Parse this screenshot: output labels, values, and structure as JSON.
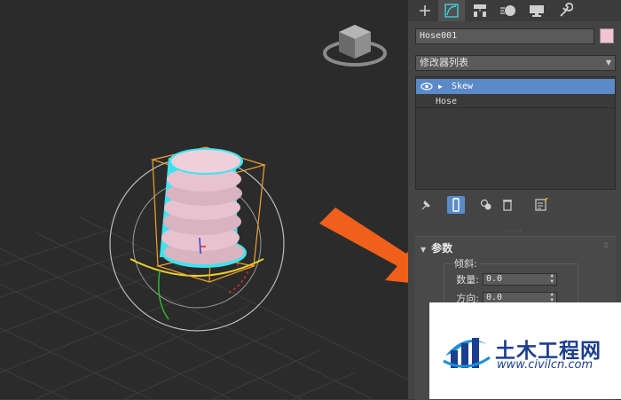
{
  "panel": {
    "tabs": [
      {
        "name": "create-tab",
        "icon": "plus-icon"
      },
      {
        "name": "modify-tab",
        "icon": "modify-curve-icon",
        "active": true
      },
      {
        "name": "hierarchy-tab",
        "icon": "hierarchy-icon"
      },
      {
        "name": "motion-tab",
        "icon": "motion-icon"
      },
      {
        "name": "display-tab",
        "icon": "display-monitor-icon"
      },
      {
        "name": "utilities-tab",
        "icon": "wrench-icon"
      }
    ],
    "object_name": "Hose001",
    "object_color": "#f2c4d3",
    "modifier_list_label": "修改器列表",
    "stack": {
      "items": [
        {
          "label": "Skew",
          "selected": true
        },
        {
          "label": "Hose",
          "selected": false
        }
      ]
    },
    "stack_tools": [
      "pin-stack-icon",
      "show-end-result-icon",
      "make-unique-icon",
      "remove-modifier-icon",
      "configure-sets-icon"
    ],
    "rollout": {
      "title": "参数",
      "group_label": "倾斜:",
      "params": [
        {
          "label": "数量:",
          "value": "0.0"
        },
        {
          "label": "方向:",
          "value": "0.0"
        }
      ]
    }
  },
  "viewport": {
    "viewcube_icon": "viewcube-icon",
    "object_color": "#e8c3cf",
    "selection_color": "#3fe3ee",
    "gizmo_color": "#f0a030"
  },
  "annotation": {
    "arrow_color": "#f0601a"
  },
  "watermark": {
    "title": "土木工程网",
    "url": "www.civilcn.com"
  }
}
